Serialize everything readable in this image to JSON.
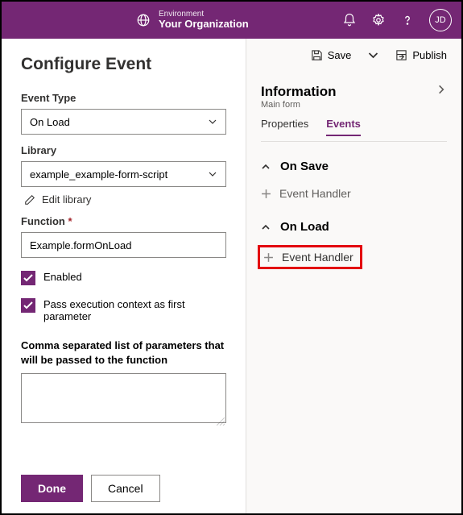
{
  "topbar": {
    "env_label": "Environment",
    "env_name": "Your Organization",
    "avatar": "JD"
  },
  "left": {
    "title": "Configure Event",
    "event_type_label": "Event Type",
    "event_type_value": "On Load",
    "library_label": "Library",
    "library_value": "example_example-form-script",
    "edit_library": "Edit library",
    "function_label": "Function",
    "function_value": "Example.formOnLoad",
    "enabled_label": "Enabled",
    "pass_ctx_label": "Pass execution context as first parameter",
    "params_label": "Comma separated list of parameters that will be passed to the function",
    "params_value": "",
    "done": "Done",
    "cancel": "Cancel"
  },
  "right": {
    "save": "Save",
    "publish": "Publish",
    "info_title": "Information",
    "info_sub": "Main form",
    "tabs": {
      "properties": "Properties",
      "events": "Events"
    },
    "sections": {
      "on_save": "On Save",
      "on_load": "On Load",
      "event_handler": "Event Handler"
    }
  }
}
